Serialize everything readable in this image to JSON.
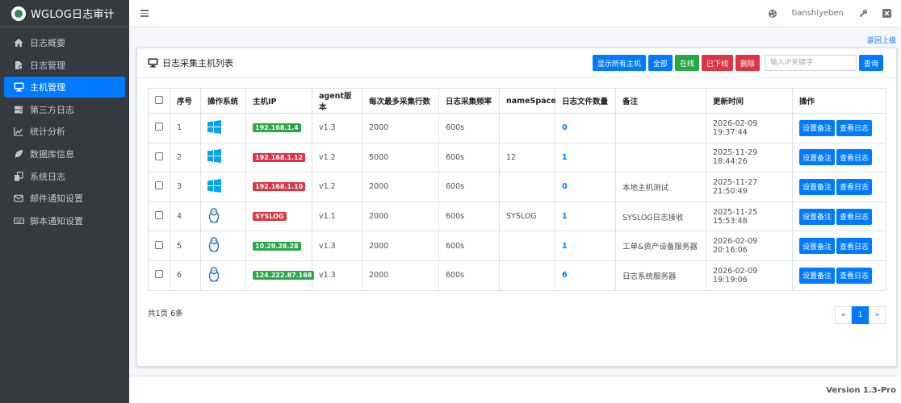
{
  "app": {
    "brand": "WGLOG日志审计"
  },
  "sidebar": {
    "items": [
      {
        "label": "日志概要",
        "icon": "home-icon",
        "active": false
      },
      {
        "label": "日志管理",
        "icon": "file-icon",
        "active": false
      },
      {
        "label": "主机管理",
        "icon": "desktop-icon",
        "active": true
      },
      {
        "label": "第三方日志",
        "icon": "server-icon",
        "active": false
      },
      {
        "label": "统计分析",
        "icon": "chart-line-icon",
        "active": false
      },
      {
        "label": "数据库信息",
        "icon": "feather-icon",
        "active": false
      },
      {
        "label": "系统日志",
        "icon": "copy-icon",
        "active": false
      },
      {
        "label": "邮件通知设置",
        "icon": "envelope-icon",
        "active": false
      },
      {
        "label": "脚本通知设置",
        "icon": "keyboard-icon",
        "active": false
      }
    ]
  },
  "topbar": {
    "username": "tianshiyeben"
  },
  "content": {
    "back_link": "返回上级"
  },
  "card": {
    "title": "日志采集主机列表",
    "buttons": {
      "show_all_hosts": "显示所有主机",
      "all": "全部",
      "online": "在线",
      "offline": "已下线",
      "delete": "删除",
      "query": "查询"
    },
    "search_placeholder": "输入IP关键字"
  },
  "table": {
    "headers": [
      "序号",
      "操作系统",
      "主机IP",
      "agent版本",
      "每次最多采集行数",
      "日志采集频率",
      "nameSpace",
      "日志文件数量",
      "备注",
      "更新时间",
      "操作"
    ],
    "rows": [
      {
        "seq": "1",
        "os": "windows",
        "ip": "192.168.1.4",
        "ip_color": "#28a745",
        "agent": "v1.3",
        "max_lines": "2000",
        "freq": "600s",
        "namespace": "",
        "file_count": "0",
        "note": "",
        "updated": "2026-02-09 19:37:44"
      },
      {
        "seq": "2",
        "os": "windows",
        "ip": "192.168.1.12",
        "ip_color": "#dc3545",
        "agent": "v1.2",
        "max_lines": "5000",
        "freq": "600s",
        "namespace": "12",
        "file_count": "1",
        "note": "",
        "updated": "2025-11-29 18:44:26"
      },
      {
        "seq": "3",
        "os": "windows",
        "ip": "192.168.1.10",
        "ip_color": "#dc3545",
        "agent": "v1.2",
        "max_lines": "2000",
        "freq": "600s",
        "namespace": "",
        "file_count": "0",
        "note": "本地主机测试",
        "updated": "2025-11-27 21:50:49"
      },
      {
        "seq": "4",
        "os": "linux",
        "ip": "SYSLOG",
        "ip_color": "#dc3545",
        "agent": "v1.1",
        "max_lines": "2000",
        "freq": "600s",
        "namespace": "SYSLOG",
        "file_count": "1",
        "note": "SYSLOG日志接收",
        "updated": "2025-11-25 15:53:48"
      },
      {
        "seq": "5",
        "os": "linux",
        "ip": "10.29.28.28",
        "ip_color": "#28a745",
        "agent": "v1.3",
        "max_lines": "2000",
        "freq": "600s",
        "namespace": "",
        "file_count": "1",
        "note": "工单&资产设备服务器",
        "updated": "2026-02-09 20:16:06"
      },
      {
        "seq": "6",
        "os": "linux",
        "ip": "124.222.87.168",
        "ip_color": "#28a745",
        "agent": "v1.3",
        "max_lines": "2000",
        "freq": "600s",
        "namespace": "",
        "file_count": "6",
        "note": "日志系统服务器",
        "updated": "2026-02-09 19:19:06"
      }
    ],
    "row_actions": {
      "set_note": "设置备注",
      "view_log": "查看日志"
    }
  },
  "pagination": {
    "summary": "共1页 6条",
    "prev": "«",
    "current": "1",
    "next": "»"
  },
  "footer": {
    "version": "Version 1.3-Pro"
  },
  "colors": {
    "accent": "#007bff",
    "success": "#28a745",
    "danger": "#dc3545",
    "sidebar_bg": "#343a40"
  }
}
